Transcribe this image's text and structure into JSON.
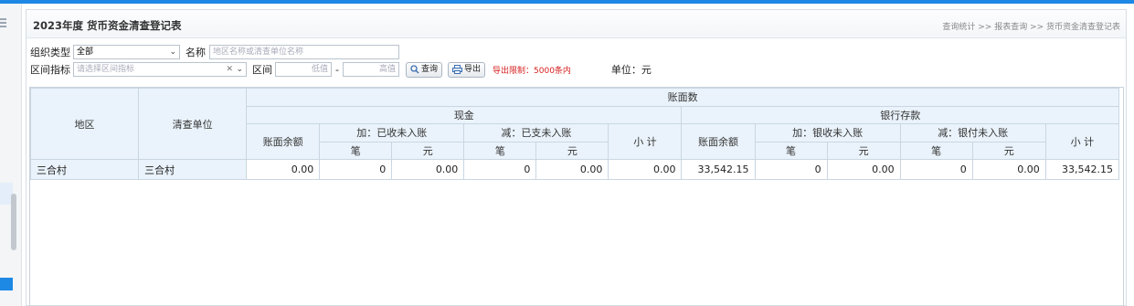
{
  "panel": {
    "title": "2023年度 货币资金清查登记表",
    "breadcrumb": "查询统计 >> 报表查询 >> 货币资金清查登记表"
  },
  "filters": {
    "org_type_label": "组织类型",
    "org_type_value": "全部",
    "name_label": "名称",
    "name_placeholder": "地区名称或清查单位名称",
    "range_label": "区间指标",
    "range_placeholder": "请选择区间指标",
    "interval_label": "区间",
    "low_placeholder": "低值",
    "dash": "-",
    "high_placeholder": "高值",
    "query_button": "查询",
    "export_button": "导出",
    "export_limit": "导出限制：5000条内",
    "unit_text": "单位：元"
  },
  "table": {
    "h_region": "地区",
    "h_unit": "清查单位",
    "h_book": "账面数",
    "h_cash": "现金",
    "h_bank": "银行存款",
    "h_balance": "账面余额",
    "h_cash_in": "加：已收未入账",
    "h_cash_out": "减：已支未入账",
    "h_bank_in": "加：银收未入账",
    "h_bank_out": "减：银付未入账",
    "h_subtotal": "小 计",
    "h_count": "笔",
    "h_amount": "元",
    "rows": [
      {
        "region": "三合村",
        "unit": "三合村",
        "cash_balance": "0.00",
        "cash_in_count": "0",
        "cash_in_amount": "0.00",
        "cash_out_count": "0",
        "cash_out_amount": "0.00",
        "cash_subtotal": "0.00",
        "bank_balance": "33,542.15",
        "bank_in_count": "0",
        "bank_in_amount": "0.00",
        "bank_out_count": "0",
        "bank_out_amount": "0.00",
        "bank_subtotal": "33,542.15"
      }
    ]
  },
  "colors": {
    "accent": "#1e88e5",
    "header_bg": "#eaf3fb",
    "warning": "#d61f1f"
  }
}
